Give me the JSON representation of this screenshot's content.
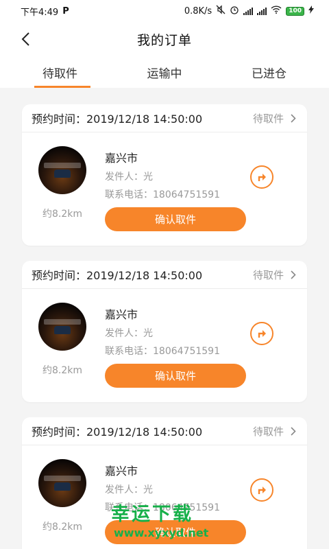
{
  "status_bar": {
    "time": "下午4:49",
    "carrier_icon": "P",
    "net_speed": "0.8K/s",
    "battery": "100"
  },
  "header": {
    "title": "我的订单"
  },
  "tabs": [
    {
      "label": "待取件",
      "active": true
    },
    {
      "label": "运输中",
      "active": false
    },
    {
      "label": "已进仓",
      "active": false
    }
  ],
  "orders": [
    {
      "appointment": "预约时间：2019/12/18 14:50:00",
      "status": "待取件",
      "city": "嘉兴市",
      "sender": "发件人：光",
      "phone": "联系电话：18064751591",
      "distance": "约8.2km",
      "confirm_label": "确认取件"
    },
    {
      "appointment": "预约时间：2019/12/18 14:50:00",
      "status": "待取件",
      "city": "嘉兴市",
      "sender": "发件人：光",
      "phone": "联系电话：18064751591",
      "distance": "约8.2km",
      "confirm_label": "确认取件"
    },
    {
      "appointment": "预约时间：2019/12/18 14:50:00",
      "status": "待取件",
      "city": "嘉兴市",
      "sender": "发件人：光",
      "phone": "联系电话：18064751591",
      "distance": "约8.2km",
      "confirm_label": "确认取件"
    }
  ],
  "watermark": {
    "text": "幸运下载",
    "url": "www.xyxyd.net"
  },
  "colors": {
    "accent": "#f7852a",
    "background": "#f4f4f4",
    "watermark": "#17b04a"
  }
}
